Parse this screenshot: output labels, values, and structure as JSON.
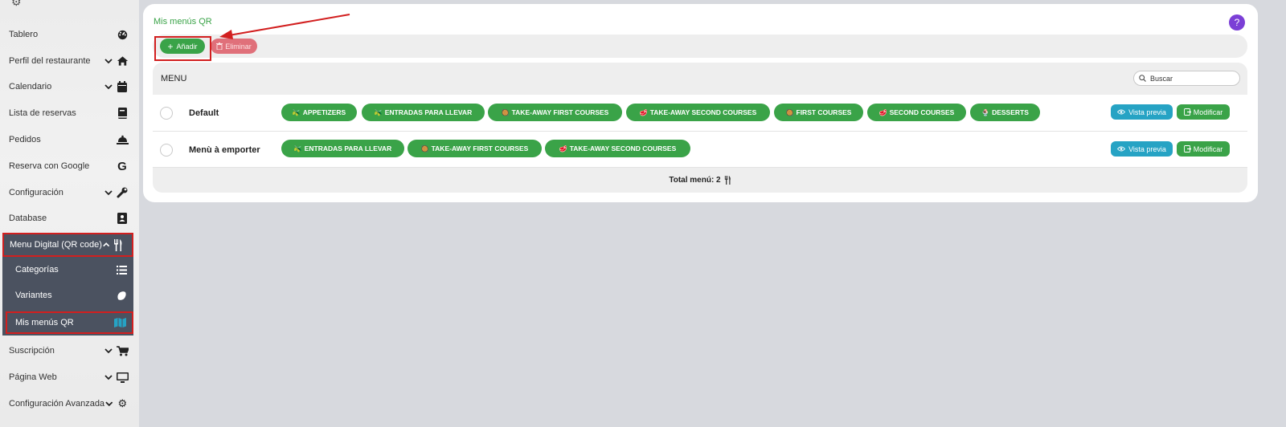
{
  "sidebar": {
    "items": [
      {
        "label": "Tablero",
        "icon": "dashboard-gauge-icon",
        "chevron": false
      },
      {
        "label": "Perfil del restaurante",
        "icon": "home-icon",
        "chevron": true
      },
      {
        "label": "Calendario",
        "icon": "calendar-icon",
        "chevron": true
      },
      {
        "label": "Lista de reservas",
        "icon": "book-icon",
        "chevron": false
      },
      {
        "label": "Pedidos",
        "icon": "bell-icon",
        "chevron": false
      },
      {
        "label": "Reserva con Google",
        "icon": "google-icon",
        "chevron": false
      },
      {
        "label": "Configuración",
        "icon": "wrench-icon",
        "chevron": true
      },
      {
        "label": "Database",
        "icon": "contact-book-icon",
        "chevron": false
      },
      {
        "label": "Menu Digital (QR code)",
        "icon": "utensils-icon",
        "chevron": true,
        "open": true
      },
      {
        "label": "Suscripción",
        "icon": "cart-icon",
        "chevron": true
      },
      {
        "label": "Página Web",
        "icon": "monitor-icon",
        "chevron": true
      },
      {
        "label": "Configuración Avanzada",
        "icon": "cogs-icon",
        "chevron": true
      }
    ],
    "submenu": [
      {
        "label": "Categorías",
        "icon": "list-icon"
      },
      {
        "label": "Variantes",
        "icon": "lemon-icon"
      },
      {
        "label": "Mis menús QR",
        "icon": "map-icon",
        "active": true
      }
    ]
  },
  "page": {
    "title": "Mis menús QR",
    "help": "?"
  },
  "toolbar": {
    "add_label": "Añadir",
    "delete_label": "Eliminar"
  },
  "table": {
    "header": "MENU",
    "search_placeholder": "Buscar",
    "rows": [
      {
        "name": "Default",
        "chips": [
          {
            "emoji": "🫒",
            "label": "APPETIZERS"
          },
          {
            "emoji": "🫒",
            "label": "ENTRADAS PARA LLEVAR"
          },
          {
            "emoji": "🥘",
            "label": "TAKE-AWAY FIRST COURSES"
          },
          {
            "emoji": "🥩",
            "label": "TAKE-AWAY SECOND COURSES"
          },
          {
            "emoji": "🥘",
            "label": "FIRST COURSES"
          },
          {
            "emoji": "🥩",
            "label": "SECOND COURSES"
          },
          {
            "emoji": "🍨",
            "label": "DESSERTS"
          }
        ]
      },
      {
        "name": "Menù à emporter",
        "chips": [
          {
            "emoji": "🫒",
            "label": "ENTRADAS PARA LLEVAR"
          },
          {
            "emoji": "🥘",
            "label": "TAKE-AWAY FIRST COURSES"
          },
          {
            "emoji": "🥩",
            "label": "TAKE-AWAY SECOND COURSES"
          }
        ]
      }
    ],
    "preview_label": "Vista previa",
    "modify_label": "Modificar",
    "footer": "Total menú: 2"
  },
  "colors": {
    "accent_green": "#3aa348",
    "danger": "#e0707a",
    "info": "#26a3c4",
    "highlight": "#d21f1f",
    "sidebar_dark": "#4b5260",
    "help_purple": "#7b3fd6"
  }
}
